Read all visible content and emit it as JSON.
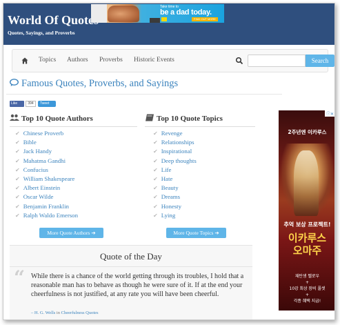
{
  "header": {
    "title": "World Of Quotes",
    "subtitle": "Quotes, Sayings, and Proverbs",
    "banner_ad": {
      "small_text": "Take time to",
      "main_text": "be a dad today.",
      "cta": "FIND OUT MORE"
    }
  },
  "nav": {
    "home_icon": "home-icon",
    "links": [
      "Topics",
      "Authors",
      "Proverbs",
      "Historic Events"
    ],
    "search_placeholder": "",
    "search_button": "Search"
  },
  "page": {
    "heading": "Famous Quotes, Proverbs, and Sayings"
  },
  "social": {
    "like_label": "Like",
    "like_count": "394",
    "tweet_label": "Tweet"
  },
  "authors": {
    "title": "Top 10 Quote Authors",
    "items": [
      "Chinese Proverb",
      "Bible",
      "Jack Handy",
      "Mahatma Gandhi",
      "Confucius",
      "William Shakespeare",
      "Albert Einstein",
      "Oscar Wilde",
      "Benjamin Franklin",
      "Ralph Waldo Emerson"
    ],
    "more_button": "More Quote Authors ➔"
  },
  "topics": {
    "title": "Top 10 Quote Topics",
    "items": [
      "Revenge",
      "Relationships",
      "Inspirational",
      "Deep thoughts",
      "Life",
      "Hate",
      "Beauty",
      "Dreams",
      "Honesty",
      "Lying"
    ],
    "more_button": "More Quote Topics ➔"
  },
  "qotd": {
    "title": "Quote of the Day",
    "text": "While there is a chance of the world getting through its troubles, I hold that a reasonable man has to behave as though he were sure of it. If at the end your cheerfulness is not justified, at any rate you will have been cheerful.",
    "author": "– H. G. Wells",
    "in_word": "in",
    "topic": "Cheerfulness Quotes"
  },
  "side_ad": {
    "top_text": "2주년엔 이카루스",
    "middle_text": "추억 보상 프로젝트!",
    "title_line1": "이카루스",
    "title_line2": "오마주",
    "bottom_line1": "재탄생 펠로우",
    "bottom_line2": "+",
    "bottom_line3": "10강 최상 장비 풀셋",
    "bottom_line4": "+",
    "bottom_line5": "각종 혜택 지급!"
  },
  "colors": {
    "header_bg": "#2f4f7e",
    "link": "#3b83bd",
    "button": "#5fb5e8"
  }
}
